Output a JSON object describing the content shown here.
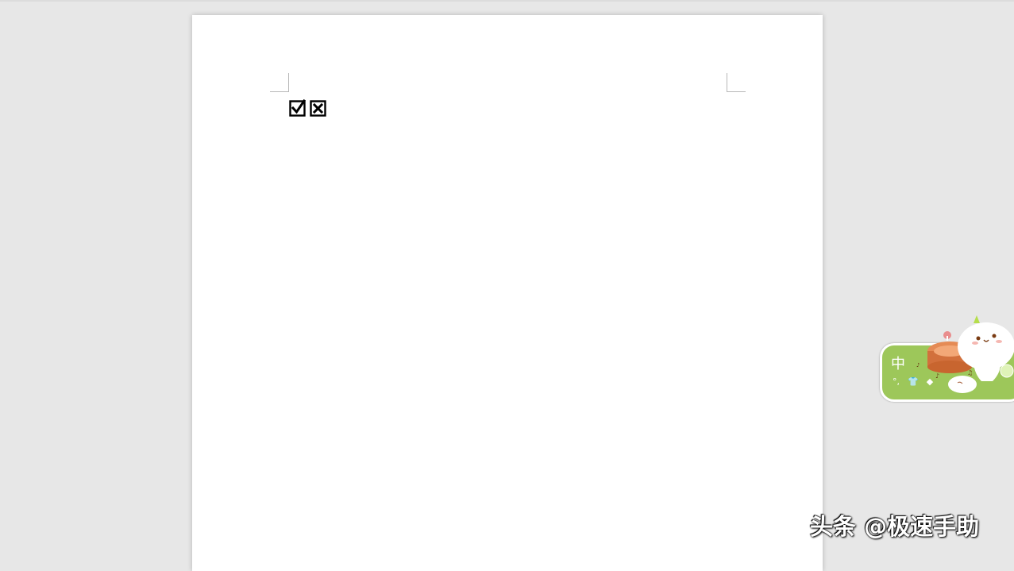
{
  "document": {
    "symbols": [
      {
        "name": "checked-box-symbol",
        "glyph": "☑"
      },
      {
        "name": "crossed-box-symbol",
        "glyph": "☒"
      }
    ]
  },
  "ime": {
    "mode_char": "中",
    "accent_color": "#9dc75a"
  },
  "watermark": {
    "text": "头条 @极速手助"
  },
  "colors": {
    "workspace_bg": "#e7e7e7",
    "page_bg": "#ffffff"
  }
}
